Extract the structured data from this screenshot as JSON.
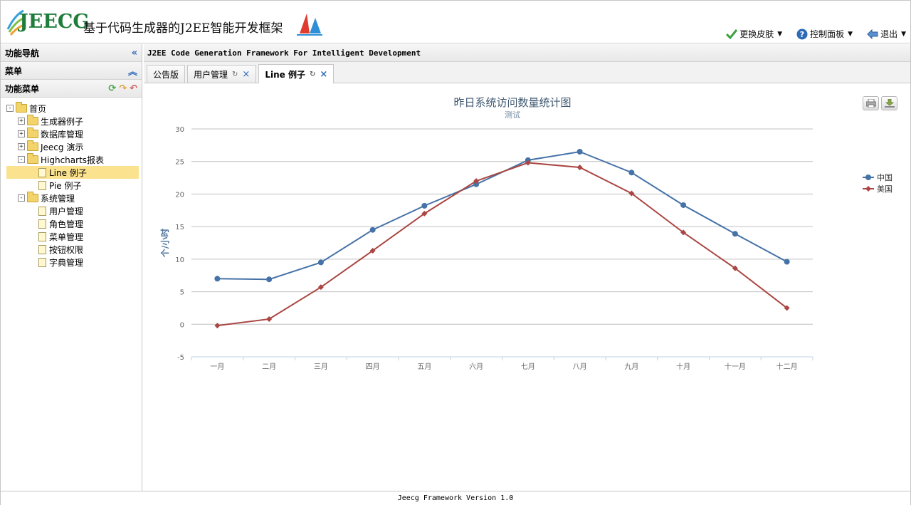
{
  "header": {
    "logo_text": "JEECG",
    "slogan": "基于代码生成器的J2EE智能开发框架",
    "menu": [
      {
        "label": "更换皮肤",
        "icon": "check-icon"
      },
      {
        "label": "控制面板",
        "icon": "help-icon"
      },
      {
        "label": "退出",
        "icon": "back-arrow-icon"
      }
    ]
  },
  "sidebar": {
    "nav_title": "功能导航",
    "menu_title": "菜单",
    "func_menu_title": "功能菜单",
    "tree": [
      {
        "label": "首页",
        "level": 0,
        "type": "folder",
        "expanded": true
      },
      {
        "label": "生成器例子",
        "level": 1,
        "type": "folder",
        "expanded": false
      },
      {
        "label": "数据库管理",
        "level": 1,
        "type": "folder",
        "expanded": false
      },
      {
        "label": "Jeecg 演示",
        "level": 1,
        "type": "folder",
        "expanded": false
      },
      {
        "label": "Highcharts报表",
        "level": 1,
        "type": "folder",
        "expanded": true
      },
      {
        "label": "Line 例子",
        "level": 2,
        "type": "file",
        "selected": true
      },
      {
        "label": "Pie 例子",
        "level": 2,
        "type": "file"
      },
      {
        "label": "系统管理",
        "level": 1,
        "type": "folder",
        "expanded": true
      },
      {
        "label": "用户管理",
        "level": 2,
        "type": "file"
      },
      {
        "label": "角色管理",
        "level": 2,
        "type": "file"
      },
      {
        "label": "菜单管理",
        "level": 2,
        "type": "file"
      },
      {
        "label": "按钮权限",
        "level": 2,
        "type": "file"
      },
      {
        "label": "字典管理",
        "level": 2,
        "type": "file"
      }
    ]
  },
  "main": {
    "title": "J2EE Code Generation Framework For Intelligent Development",
    "tabs": [
      {
        "label": "公告版",
        "closable": false,
        "active": false
      },
      {
        "label": "用户管理",
        "closable": true,
        "active": false
      },
      {
        "label": "Line 例子",
        "closable": true,
        "active": true
      }
    ]
  },
  "chart_data": {
    "type": "line",
    "title": "昨日系统访问数量统计图",
    "subtitle": "测试",
    "ylabel": "个/小时",
    "xlabel": "",
    "categories": [
      "一月",
      "二月",
      "三月",
      "四月",
      "五月",
      "六月",
      "七月",
      "八月",
      "九月",
      "十月",
      "十一月",
      "十二月"
    ],
    "ylim": [
      -5,
      30
    ],
    "yticks": [
      -5,
      0,
      5,
      10,
      15,
      20,
      25,
      30
    ],
    "grid": true,
    "legend_position": "right",
    "series": [
      {
        "name": "中国",
        "color": "#4572a7",
        "marker": "circle",
        "values": [
          7.0,
          6.9,
          9.5,
          14.5,
          18.2,
          21.5,
          25.2,
          26.5,
          23.3,
          18.3,
          13.9,
          9.6
        ]
      },
      {
        "name": "美国",
        "color": "#aa4643",
        "marker": "diamond",
        "values": [
          -0.2,
          0.8,
          5.7,
          11.3,
          17.0,
          22.0,
          24.8,
          24.1,
          20.1,
          14.1,
          8.6,
          2.5
        ]
      }
    ]
  },
  "footer": {
    "text": "Jeecg Framework Version 1.0"
  }
}
